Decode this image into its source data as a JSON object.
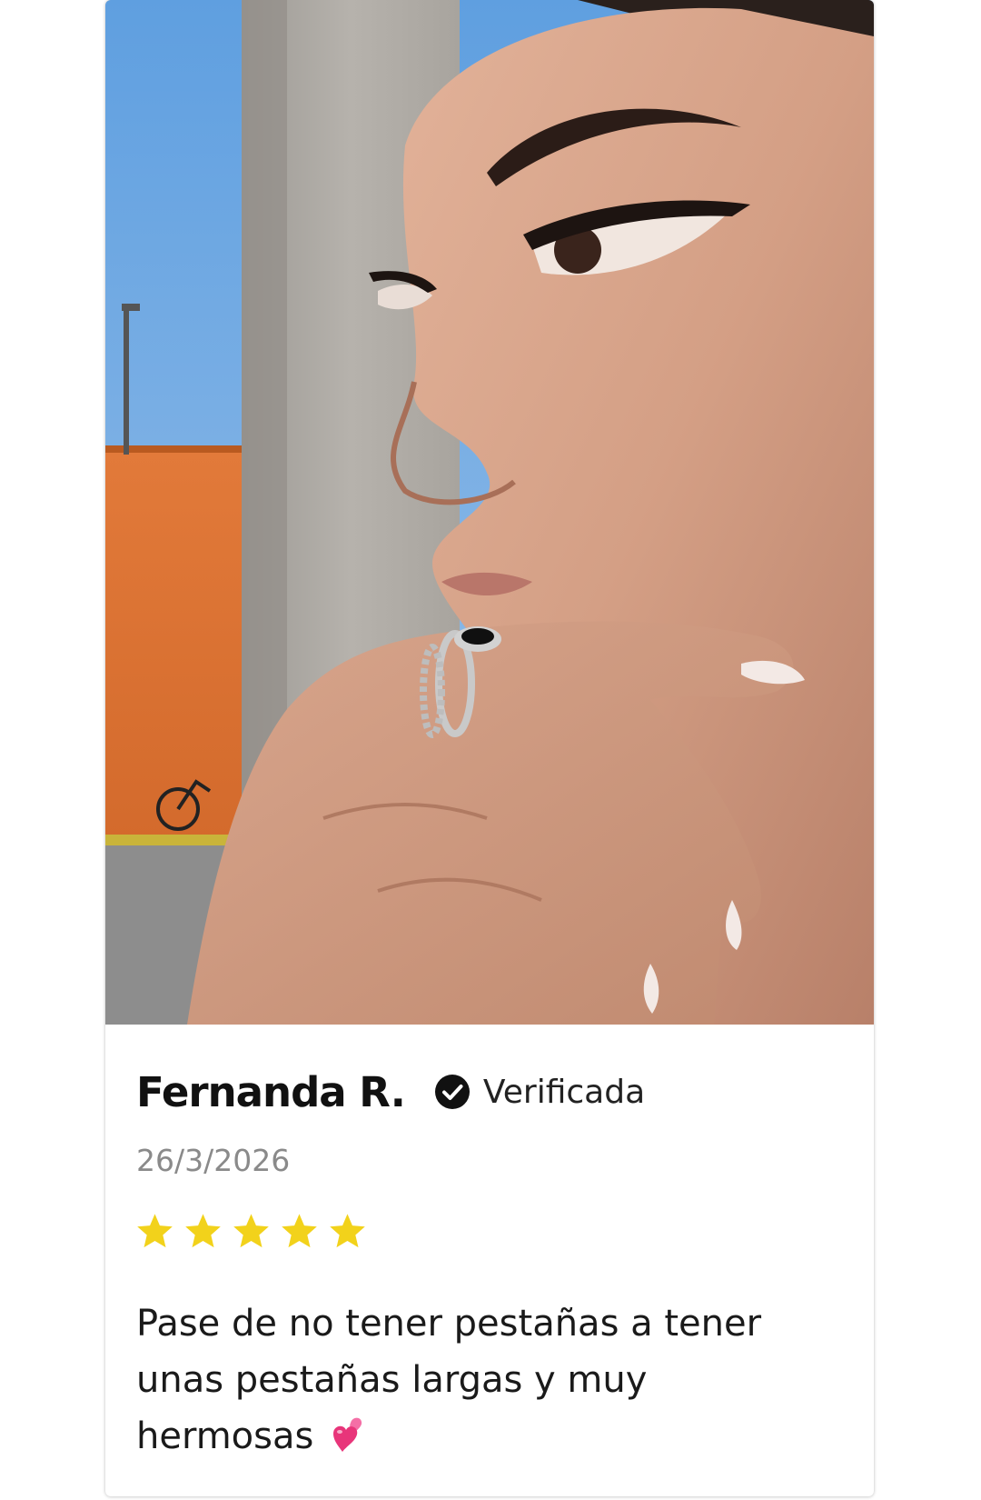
{
  "review_card": {
    "photo_alt": "Foto de la reseña",
    "author_name": "Fernanda R.",
    "verified_label": "Verificada",
    "date": "26/3/2026",
    "rating": 5,
    "rating_max": 5,
    "review_text": "Pase de no tener pestañas a tener unas pestañas largas y muy hermosas",
    "review_emoji": "two-hearts-icon",
    "colors": {
      "star": "#f2d21b",
      "verified_badge": "#111111",
      "emoji_heart_front": "#e8357a",
      "emoji_heart_back": "#f46fa6"
    }
  }
}
